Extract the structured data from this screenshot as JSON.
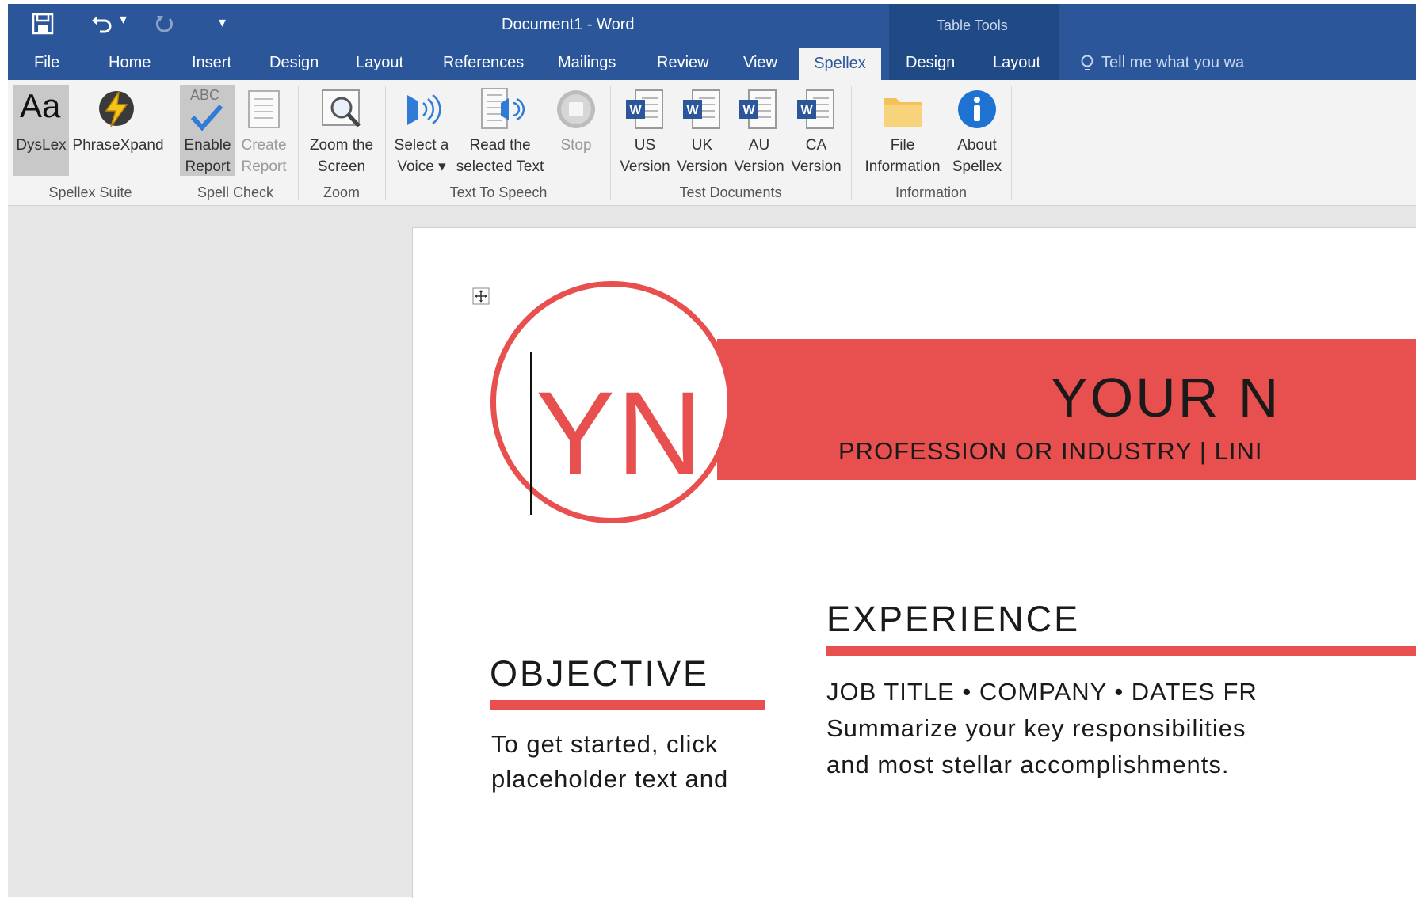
{
  "window": {
    "title": "Document1 - Word",
    "contextual_group": "Table Tools"
  },
  "qat": {
    "undo_arrow": "▾",
    "customize": "▾"
  },
  "tabs": [
    "File",
    "Home",
    "Insert",
    "Design",
    "Layout",
    "References",
    "Mailings",
    "Review",
    "View",
    "Spellex",
    "Design",
    "Layout"
  ],
  "tell_me": "Tell me what you wa",
  "ribbon": {
    "buttons": {
      "dyslex": "DysLex",
      "dyslex_glyph": "Aa",
      "phrasexpand": "PhraseXpand",
      "enable_report": [
        "Enable",
        "Report"
      ],
      "create_report": [
        "Create",
        "Report"
      ],
      "zoom": [
        "Zoom the",
        "Screen"
      ],
      "select_voice": [
        "Select a",
        "Voice ▾"
      ],
      "read_selected": [
        "Read the",
        "selected Text"
      ],
      "stop": "Stop",
      "us_version": [
        "US",
        "Version"
      ],
      "uk_version": [
        "UK",
        "Version"
      ],
      "au_version": [
        "AU",
        "Version"
      ],
      "ca_version": [
        "CA",
        "Version"
      ],
      "file_info": [
        "File",
        "Information"
      ],
      "about": [
        "About",
        "Spellex"
      ],
      "abc": "ABC"
    },
    "groups": [
      "Spellex Suite",
      "Spell Check",
      "Zoom",
      "Text To Speech",
      "Test Documents",
      "Information"
    ]
  },
  "document": {
    "initials": "YN",
    "name": "YOUR N",
    "profession": "PROFESSION OR INDUSTRY | LINI",
    "objective_heading": "OBJECTIVE",
    "objective_text": [
      "To get started, click",
      "placeholder text and"
    ],
    "experience_heading": "EXPERIENCE",
    "experience_line": "JOB TITLE • COMPANY • DATES FR",
    "experience_text": [
      "Summarize your key responsibilities",
      "and most stellar accomplishments."
    ]
  },
  "colors": {
    "accent": "#e84f4f",
    "word_blue": "#2b579a",
    "ribbon_bg": "#f3f3f3"
  }
}
